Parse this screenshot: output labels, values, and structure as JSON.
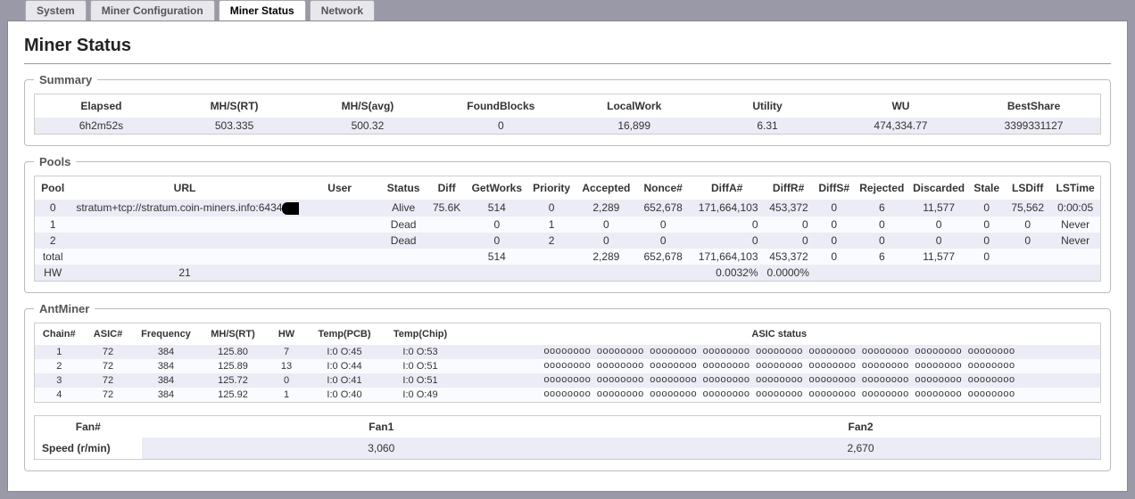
{
  "tabs": {
    "system": "System",
    "config": "Miner Configuration",
    "status": "Miner Status",
    "network": "Network"
  },
  "title": "Miner Status",
  "summary": {
    "legend": "Summary",
    "headers": {
      "elapsed": "Elapsed",
      "mhs_rt": "MH/S(RT)",
      "mhs_avg": "MH/S(avg)",
      "found": "FoundBlocks",
      "localwork": "LocalWork",
      "utility": "Utility",
      "wu": "WU",
      "bestshare": "BestShare"
    },
    "values": {
      "elapsed": "6h2m52s",
      "mhs_rt": "503.335",
      "mhs_avg": "500.32",
      "found": "0",
      "localwork": "16,899",
      "utility": "6.31",
      "wu": "474,334.77",
      "bestshare": "3399331127"
    }
  },
  "pools": {
    "legend": "Pools",
    "headers": {
      "pool": "Pool",
      "url": "URL",
      "user": "User",
      "status": "Status",
      "diff": "Diff",
      "getworks": "GetWorks",
      "priority": "Priority",
      "accepted": "Accepted",
      "nonce": "Nonce#",
      "diffa": "DiffA#",
      "diffr": "DiffR#",
      "diffs": "DiffS#",
      "rejected": "Rejected",
      "discarded": "Discarded",
      "stale": "Stale",
      "lsdiff": "LSDiff",
      "lstime": "LSTime"
    },
    "rows": [
      {
        "pool": "0",
        "url": "stratum+tcp://stratum.coin-miners.info:6434",
        "user_redacted": true,
        "status": "Alive",
        "diff": "75.6K",
        "getworks": "514",
        "priority": "0",
        "accepted": "2,289",
        "nonce": "652,678",
        "diffa": "171,664,103",
        "diffr": "453,372",
        "diffs": "0",
        "rejected": "6",
        "discarded": "11,577",
        "stale": "0",
        "lsdiff": "75,562",
        "lstime": "0:00:05"
      },
      {
        "pool": "1",
        "url": "",
        "user_redacted": false,
        "status": "Dead",
        "diff": "",
        "getworks": "0",
        "priority": "1",
        "accepted": "0",
        "nonce": "0",
        "diffa": "0",
        "diffr": "0",
        "diffs": "0",
        "rejected": "0",
        "discarded": "0",
        "stale": "0",
        "lsdiff": "0",
        "lstime": "Never"
      },
      {
        "pool": "2",
        "url": "",
        "user_redacted": false,
        "status": "Dead",
        "diff": "",
        "getworks": "0",
        "priority": "2",
        "accepted": "0",
        "nonce": "0",
        "diffa": "0",
        "diffr": "0",
        "diffs": "0",
        "rejected": "0",
        "discarded": "0",
        "stale": "0",
        "lsdiff": "0",
        "lstime": "Never"
      }
    ],
    "total": {
      "label": "total",
      "getworks": "514",
      "accepted": "2,289",
      "nonce": "652,678",
      "diffa": "171,664,103",
      "diffr": "453,372",
      "diffs": "0",
      "rejected": "6",
      "discarded": "11,577",
      "stale": "0"
    },
    "hw": {
      "label": "HW",
      "value": "21",
      "pct_a": "0.0032%",
      "pct_b": "0.0000%"
    }
  },
  "antminer": {
    "legend": "AntMiner",
    "headers": {
      "chain": "Chain#",
      "asic": "ASIC#",
      "freq": "Frequency",
      "mhs": "MH/S(RT)",
      "hw": "HW",
      "tpcb": "Temp(PCB)",
      "tchip": "Temp(Chip)",
      "asic_status": "ASIC status"
    },
    "rows": [
      {
        "chain": "1",
        "asic": "72",
        "freq": "384",
        "mhs": "125.80",
        "hw": "7",
        "tpcb": "I:0 O:45",
        "tchip": "I:0 O:53",
        "status": "oooooooo oooooooo oooooooo oooooooo oooooooo oooooooo oooooooo oooooooo oooooooo"
      },
      {
        "chain": "2",
        "asic": "72",
        "freq": "384",
        "mhs": "125.89",
        "hw": "13",
        "tpcb": "I:0 O:44",
        "tchip": "I:0 O:51",
        "status": "oooooooo oooooooo oooooooo oooooooo oooooooo oooooooo oooooooo oooooooo oooooooo"
      },
      {
        "chain": "3",
        "asic": "72",
        "freq": "384",
        "mhs": "125.72",
        "hw": "0",
        "tpcb": "I:0 O:41",
        "tchip": "I:0 O:51",
        "status": "oooooooo oooooooo oooooooo oooooooo oooooooo oooooooo oooooooo oooooooo oooooooo"
      },
      {
        "chain": "4",
        "asic": "72",
        "freq": "384",
        "mhs": "125.92",
        "hw": "1",
        "tpcb": "I:0 O:40",
        "tchip": "I:0 O:49",
        "status": "oooooooo oooooooo oooooooo oooooooo oooooooo oooooooo oooooooo oooooooo oooooooo"
      }
    ],
    "fans": {
      "headers": {
        "fan_no": "Fan#",
        "fan1": "Fan1",
        "fan2": "Fan2"
      },
      "speed_label": "Speed (r/min)",
      "fan1": "3,060",
      "fan2": "2,670"
    }
  }
}
